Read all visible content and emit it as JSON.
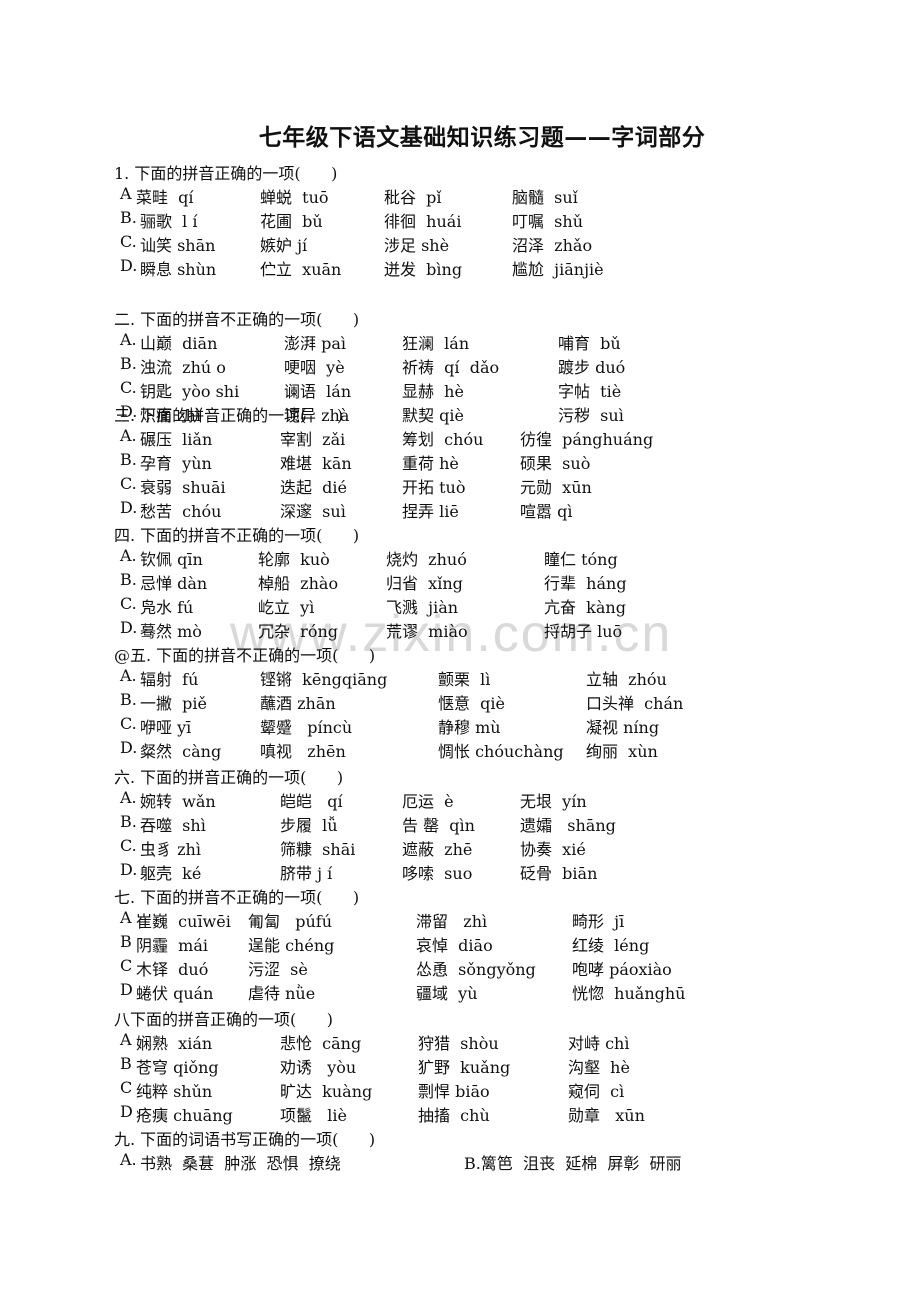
{
  "title": "七年级下语文基础知识练习题——字词部分",
  "watermark": "www.zixin.com.cn",
  "questions": [
    {
      "heading": "1. 下面的拼音正确的一项(      )",
      "options": [
        {
          "label": "A",
          "items": [
            "菜畦  qí",
            "蝉蜕  tuō",
            "秕谷  pǐ",
            "脑髓  suǐ"
          ]
        },
        {
          "label": "B.",
          "items": [
            "骊歌  l í",
            "花圃  bǔ",
            "徘徊  huái",
            "叮嘱  shǔ"
          ]
        },
        {
          "label": "C.",
          "items": [
            "讪笑 shān",
            "嫉妒 jí",
            "涉足 shè",
            "沼泽  zhǎo"
          ]
        },
        {
          "label": "D.",
          "items": [
            "瞬息 shùn",
            "伫立  xuān",
            "迸发  bìng",
            "尴尬  jiānjiè"
          ]
        }
      ]
    },
    {
      "heading": "二. 下面的拼音不正确的一项(      )",
      "options": [
        {
          "label": "A.",
          "items": [
            "山巅  diān",
            "澎湃 paì",
            "狂澜  lán",
            "哺育  bǔ"
          ]
        },
        {
          "label": "B.",
          "items": [
            "浊流  zhú o",
            "哽咽  yè",
            "祈祷  qí  dǎo",
            "踱步 duó"
          ]
        },
        {
          "label": "C.",
          "items": [
            "钥匙  yòo shi",
            "谰语  lán",
            "显赫  hè",
            "字帖  tiè"
          ]
        },
        {
          "label": "D.",
          "items": [
            "炽痛 zhì",
            "诧异 zhà",
            "默契 qiè",
            "污秽  suì"
          ]
        }
      ]
    },
    {
      "heading": "三. 下面的拼音正确的一项(      )",
      "options": [
        {
          "label": "A.",
          "items": [
            "碾压  liǎn",
            "宰割  zǎi",
            "筹划  chóu",
            "彷徨  pánghuáng"
          ]
        },
        {
          "label": "B.",
          "items": [
            "孕育  yùn",
            "难堪  kān",
            "重荷 hè",
            "硕果  suò"
          ]
        },
        {
          "label": "C.",
          "items": [
            "衰弱  shuāi",
            "迭起  dié",
            "开拓 tuò",
            "元勋  xūn"
          ]
        },
        {
          "label": "D.",
          "items": [
            "愁苦  chóu",
            "深邃  suì",
            "捏弄 liē",
            "喧嚣 qì"
          ]
        }
      ]
    },
    {
      "heading": "四. 下面的拼音不正确的一项(      )",
      "options": [
        {
          "label": "A.",
          "items": [
            "钦佩 qīn",
            "轮廓  kuò",
            "烧灼  zhuó",
            "瞳仁 tóng"
          ]
        },
        {
          "label": "B.",
          "items": [
            "忌惮 dàn",
            "棹船  zhào",
            "归省  xǐng",
            "行辈  háng"
          ]
        },
        {
          "label": "C.",
          "items": [
            "凫水 fú",
            "屹立  yì",
            "飞溅  jiàn",
            "亢奋  kàng"
          ]
        },
        {
          "label": "D.",
          "items": [
            "蓦然 mò",
            "冗杂  róng",
            "荒谬  miào",
            "捋胡子 luō"
          ]
        }
      ]
    },
    {
      "heading": "@五. 下面的拼音不正确的一项(      )",
      "options": [
        {
          "label": "A.",
          "items": [
            "辐射  fú",
            "铿锵  kēngqiāng",
            "颤栗  lì",
            "立轴  zhóu"
          ]
        },
        {
          "label": "B.",
          "items": [
            "一撇  piě",
            "蘸酒 zhān",
            "惬意  qiè",
            "口头禅  chán"
          ]
        },
        {
          "label": "C.",
          "items": [
            "咿哑 yī",
            "颦蹙   píncù",
            "静穆 mù",
            "凝视 níng"
          ]
        },
        {
          "label": "D.",
          "items": [
            "粲然  càng",
            "嗔视   zhēn",
            "惆怅 chóuchàng",
            "绚丽  xùn"
          ]
        }
      ]
    },
    {
      "heading": "六. 下面的拼音正确的一项(      )",
      "options": [
        {
          "label": "A.",
          "items": [
            "婉转  wǎn",
            "皑皑   qí",
            "厄运  è",
            "无垠  yín"
          ]
        },
        {
          "label": "B.",
          "items": [
            "吞噬  shì",
            "步履  lǚ",
            "告 罄  qìn",
            "遗孀   shāng"
          ]
        },
        {
          "label": "C.",
          "items": [
            "虫豸 zhì",
            "筛糠  shāi",
            "遮蔽  zhē",
            "协奏  xié"
          ]
        },
        {
          "label": "D.",
          "items": [
            "躯壳  ké",
            "脐带 j í",
            "哆嗦  suo",
            "砭骨  biān"
          ]
        }
      ]
    },
    {
      "heading": "七. 下面的拼音不正确的一项(      )",
      "options": [
        {
          "label": "A",
          "items": [
            "崔巍  cuīwēi",
            "匍匐   púfú",
            "滞留   zhì",
            "畸形  jī"
          ]
        },
        {
          "label": "B",
          "items": [
            "阴霾  mái",
            "逞能 chéng",
            "哀悼  diāo",
            "红绫  léng"
          ]
        },
        {
          "label": "C",
          "items": [
            "木铎  duó",
            "污涩  sè",
            "怂恿  sǒngyǒng",
            "咆哮 páoxiào"
          ]
        },
        {
          "label": "D",
          "items": [
            "蜷伏 quán",
            "虐待 nǜe",
            "疆域  yù",
            "恍惚  huǎnghū"
          ]
        }
      ]
    },
    {
      "heading": "八下面的拼音正确的一项(      )",
      "options": [
        {
          "label": "A",
          "items": [
            "娴熟  xián",
            "悲怆  cāng",
            "狩猎  shòu",
            "对峙 chì"
          ]
        },
        {
          "label": "B",
          "items": [
            "苍穹 qiǒng",
            "劝诱   yòu",
            "犷野  kuǎng",
            "沟壑  hè"
          ]
        },
        {
          "label": "C",
          "items": [
            "纯粹 shǔn",
            "旷达  kuàng",
            "剽悍 biāo",
            "窥伺  cì"
          ]
        },
        {
          "label": "D",
          "items": [
            "疮痍 chuāng",
            "项鬣   liè",
            "抽搐  chù",
            "勋章   xūn"
          ]
        }
      ]
    },
    {
      "heading": "九. 下面的词语书写正确的一项(      )",
      "options": [
        {
          "label": "A.",
          "items": [
            "书熟  桑葚  肿涨  恐惧  撩绕",
            "",
            "B.篱笆  沮丧  延棉  屏彰  研丽",
            ""
          ]
        }
      ]
    }
  ]
}
